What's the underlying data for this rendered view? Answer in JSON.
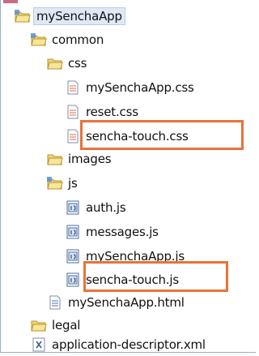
{
  "tree": {
    "root": {
      "label": "mySenchaApp"
    },
    "common": {
      "label": "common"
    },
    "css": {
      "label": "css"
    },
    "css_files": [
      "mySenchaApp.css",
      "reset.css",
      "sencha-touch.css"
    ],
    "images": {
      "label": "images"
    },
    "js": {
      "label": "js"
    },
    "js_files": [
      "auth.js",
      "messages.js",
      "mySenchaApp.js",
      "sencha-touch.js"
    ],
    "html_file": {
      "label": "mySenchaApp.html"
    },
    "legal": {
      "label": "legal"
    },
    "descriptor": {
      "label": "application-descriptor.xml"
    }
  },
  "colors": {
    "highlight": "#e8733a",
    "selection": "#dfe9f6",
    "folder": "#f2d675"
  }
}
